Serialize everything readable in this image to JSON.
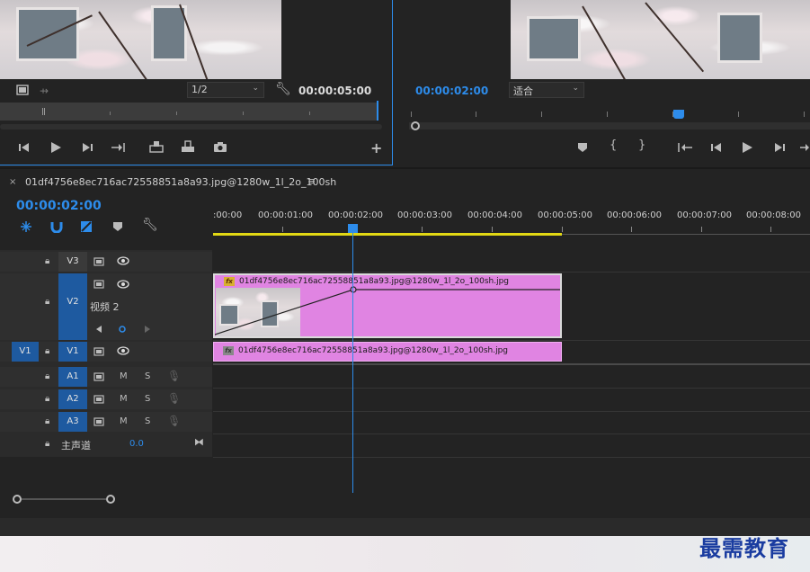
{
  "source_monitor": {
    "resolution": "1/2",
    "timecode": "00:00:05:00",
    "icons": [
      "film-icon",
      "insert-arrow-icon",
      "wrench-icon",
      "mark-in-icon",
      "play-icon",
      "step-forward-icon",
      "go-to-out-icon",
      "insert-icon",
      "overwrite-icon",
      "camera-icon",
      "plus-icon"
    ]
  },
  "program_monitor": {
    "timecode": "00:00:02:00",
    "fit": "适合",
    "icons": [
      "marker-icon",
      "mark-in-icon",
      "mark-out-icon",
      "go-to-in-icon",
      "step-back-icon",
      "play-icon",
      "step-forward-icon"
    ]
  },
  "timeline": {
    "sequence_name": "01df4756e8ec716ac72558851a8a93.jpg@1280w_1l_2o_100sh",
    "close_glyph": "×",
    "menu_glyph": "≡",
    "timecode": "00:00:02:00",
    "ruler_labels": [
      ":00:00",
      "00:00:01:00",
      "00:00:02:00",
      "00:00:03:00",
      "00:00:04:00",
      "00:00:05:00",
      "00:00:06:00",
      "00:00:07:00",
      "00:00:08:00"
    ],
    "tracks": {
      "v3": "V3",
      "v2": "V2",
      "v2_name": "视频 2",
      "v1_source": "V1",
      "v1": "V1",
      "a1": "A1",
      "a2": "A2",
      "a3": "A3",
      "master_label": "主声道",
      "master_value": "0.0",
      "mute": "M",
      "solo": "S"
    },
    "clips": {
      "v2_clip": "01df4756e8ec716ac72558851a8a93.jpg@1280w_1l_2o_100sh.jpg",
      "v1_clip": "01df4756e8ec716ac72558851a8a93.jpg@1280w_1l_2o_100sh.jpg",
      "fx_label": "fx"
    },
    "accent": "#2d8ceb",
    "clip_color": "#e084e2",
    "work_area_color": "#e2d814"
  },
  "watermark": "最需教育"
}
